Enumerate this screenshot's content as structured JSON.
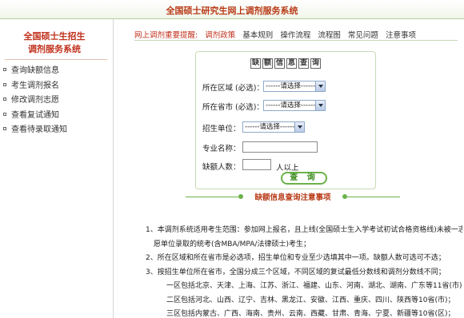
{
  "header": {
    "title": "全国硕士研究生网上调剂服务系统"
  },
  "sidebar": {
    "brand_line1": "全国硕士生招生",
    "brand_line2": "调剂服务系统",
    "items": [
      {
        "label": "查询缺额信息"
      },
      {
        "label": "考生调剂报名"
      },
      {
        "label": "修改调剂志愿"
      },
      {
        "label": "查看复试通知"
      },
      {
        "label": "查看待录取通知"
      }
    ]
  },
  "tabs": {
    "notice_label": "网上调剂重要提醒:",
    "items": [
      {
        "label": "调剂政策"
      },
      {
        "label": "基本规则"
      },
      {
        "label": "操作流程"
      },
      {
        "label": "流程图"
      },
      {
        "label": "常见问题"
      },
      {
        "label": "注意事项"
      }
    ]
  },
  "query": {
    "title_chars": [
      "缺",
      "额",
      "信",
      "息",
      "查",
      "询"
    ],
    "region_label": "所在区域 (必选)：",
    "region_value": "------请选择------",
    "province_label": "所在省市 (必选)：",
    "province_value": "------请选择------",
    "unit_label": "招生单位：",
    "unit_value": "------请选择------",
    "major_label": "专业名称：",
    "major_value": "",
    "vacancy_label": "缺额人数：",
    "vacancy_value": "",
    "vacancy_suffix": "人以上",
    "submit_label": "查 询"
  },
  "notes": {
    "heading": "缺额信息查询注意事项",
    "lines": [
      "1、本调剂系统适用考生范围：参加网上报名，且上线(全国硕士生入学考试初试合格资格线)未被一志",
      "愿单位录取的统考(含MBA/MPA/法律硕士)考生；",
      "2、所在区域和所在省市是必选项，招生单位和专业至少选填其中一项。缺额人数可选可不选；",
      "3、按招生单位所在省市，全国分成三个区域，不同区域的复试最低分数线和调剂分数线不同；",
      "一区包括北京、天津、上海、江苏、浙江、福建、山东、河南、湖北、湖南、广东等11省(市)；",
      "二区包括河北、山西、辽宁、吉林、黑龙江、安徽、江西、重庆、四川、陕西等10省(市)；",
      "三区包括内蒙古、广西、海南、贵州、云南、西藏、甘肃、青海、宁夏、新疆等10省(区)；"
    ]
  }
}
